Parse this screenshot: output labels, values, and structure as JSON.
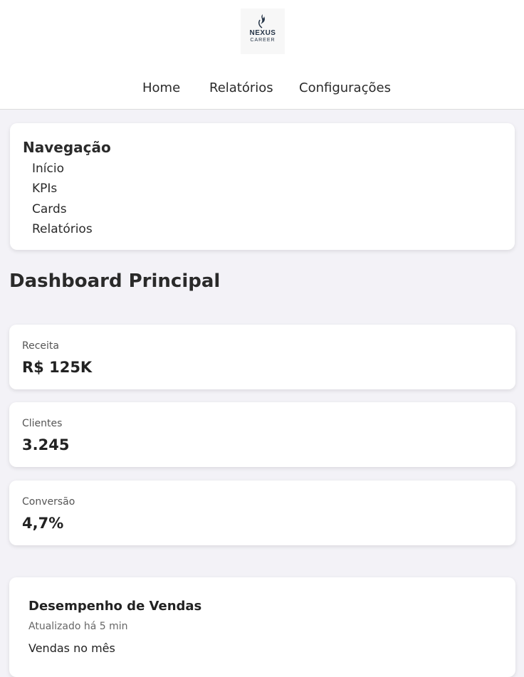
{
  "brand": {
    "name": "NEXUS",
    "tagline": "CAREER"
  },
  "top_nav": [
    "Home",
    "Relatórios",
    "Configurações"
  ],
  "sidebar": {
    "title": "Navegação",
    "items": [
      "Início",
      "KPIs",
      "Cards",
      "Relatórios"
    ]
  },
  "page": {
    "title": "Dashboard Principal"
  },
  "kpis": [
    {
      "label": "Receita",
      "value": "R$ 125K"
    },
    {
      "label": "Clientes",
      "value": "3.245"
    },
    {
      "label": "Conversão",
      "value": "4,7%"
    }
  ],
  "performance": {
    "title": "Desempenho de Vendas",
    "updated": "Atualizado há 5 min",
    "metric_label": "Vendas no mês"
  },
  "colors": {
    "background": "#f3f2f7",
    "card": "#ffffff",
    "logo_ink": "#253447"
  }
}
